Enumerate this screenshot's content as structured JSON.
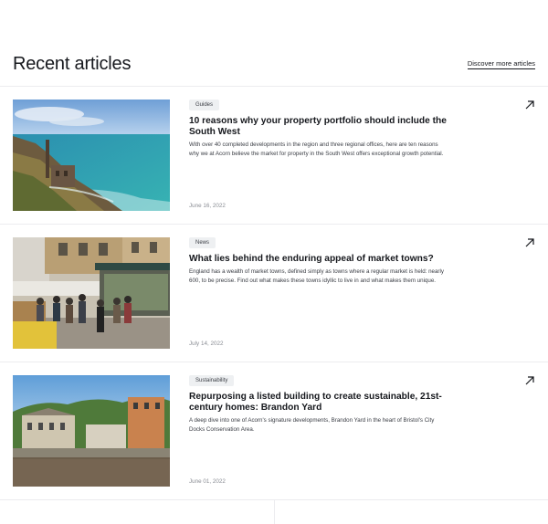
{
  "section": {
    "title": "Recent articles",
    "discover_label": "Discover more articles"
  },
  "articles": [
    {
      "tag": "Guides",
      "title": "10 reasons why your property portfolio should include the South West",
      "excerpt": "With over 40 completed developments in the region and three regional offices, here are ten reasons why we at Acorn believe the market for property in the South West offers exceptional growth potential.",
      "date": "June 16, 2022",
      "image_alt": "coastal-mine-image"
    },
    {
      "tag": "News",
      "title": "What lies behind the enduring appeal of market towns?",
      "excerpt": "England has a wealth of market towns, defined simply as towns where a regular market is held: nearly 600, to be precise. Find out what makes these towns idyllic to live in and what makes them unique.",
      "date": "July 14, 2022",
      "image_alt": "market-street-image"
    },
    {
      "tag": "Sustainability",
      "title": "Repurposing a listed building to create sustainable, 21st-century homes: Brandon Yard",
      "excerpt": "A deep dive into one of Acorn's signature developments, Brandon Yard in the heart of Bristol's City Docks Conservation Area.",
      "date": "June 01, 2022",
      "image_alt": "harbour-buildings-image"
    }
  ]
}
